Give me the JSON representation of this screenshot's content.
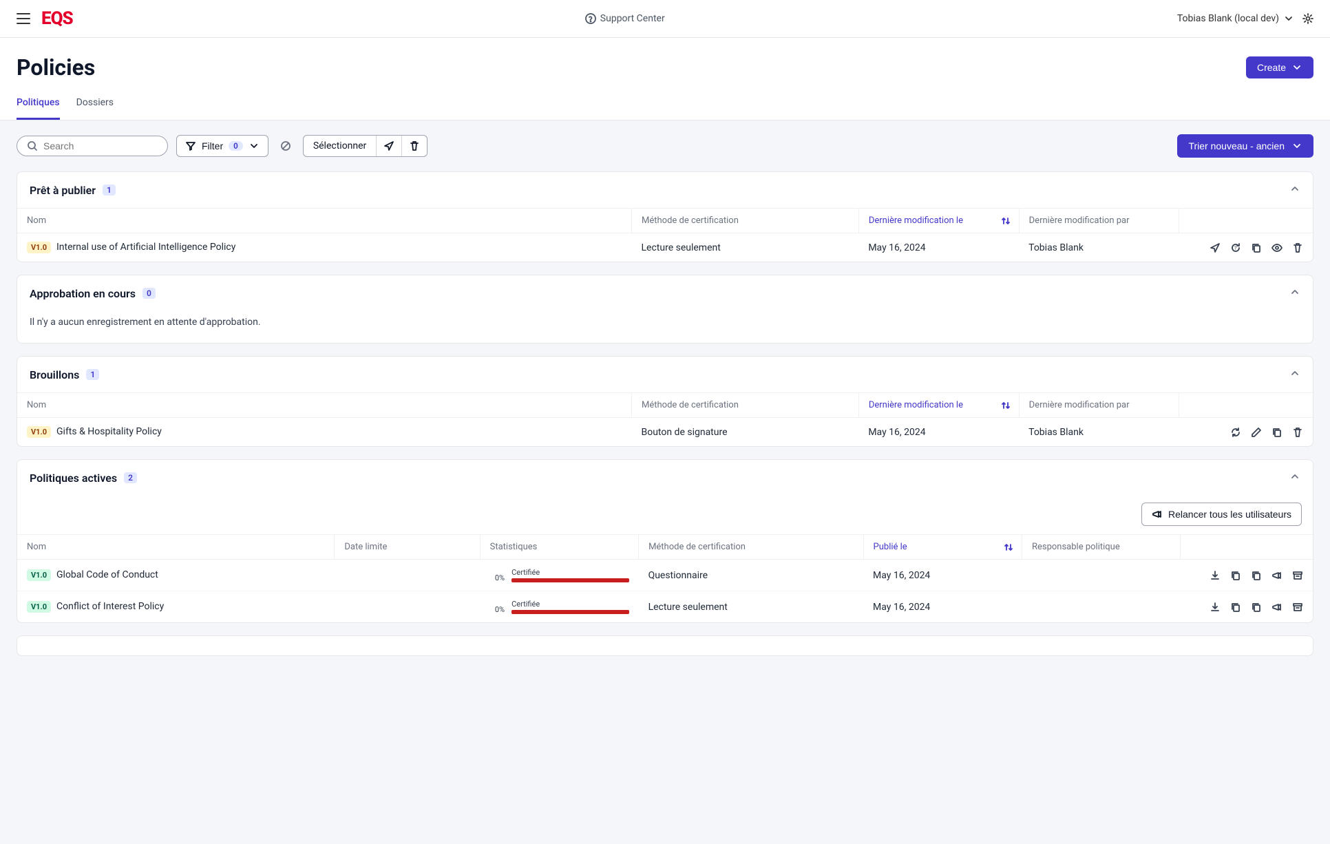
{
  "header": {
    "support_label": "Support Center",
    "user_label": "Tobias Blank (local dev)"
  },
  "page": {
    "title": "Policies",
    "create_label": "Create",
    "tabs": {
      "policies": "Politiques",
      "folders": "Dossiers"
    }
  },
  "toolbar": {
    "search_placeholder": "Search",
    "filter_label": "Filter",
    "filter_count": "0",
    "select_label": "Sélectionner",
    "sort_label": "Trier nouveau - ancien"
  },
  "columns": {
    "name": "Nom",
    "method": "Méthode de certification",
    "modified_on": "Dernière modification le",
    "modified_by": "Dernière modification par",
    "deadline": "Date limite",
    "stats": "Statistiques",
    "published_on": "Publié le",
    "owner": "Responsable politique"
  },
  "sections": {
    "ready": {
      "title": "Prêt à publier",
      "count": "1",
      "rows": [
        {
          "version": "V1.0",
          "name": "Internal use of Artificial Intelligence Policy",
          "method": "Lecture seulement",
          "date": "May 16, 2024",
          "user": "Tobias Blank"
        }
      ]
    },
    "approval": {
      "title": "Approbation en cours",
      "count": "0",
      "empty": "Il n'y a aucun enregistrement en attente d'approbation."
    },
    "drafts": {
      "title": "Brouillons",
      "count": "1",
      "rows": [
        {
          "version": "V1.0",
          "name": "Gifts & Hospitality Policy",
          "method": "Bouton de signature",
          "date": "May 16, 2024",
          "user": "Tobias Blank"
        }
      ]
    },
    "active": {
      "title": "Politiques actives",
      "count": "2",
      "remind_label": "Relancer tous les utilisateurs",
      "stat_label": "Certifiée",
      "rows": [
        {
          "version": "V1.0",
          "name": "Global Code of Conduct",
          "pct": "0%",
          "method": "Questionnaire",
          "date": "May 16, 2024"
        },
        {
          "version": "V1.0",
          "name": "Conflict of Interest Policy",
          "pct": "0%",
          "method": "Lecture seulement",
          "date": "May 16, 2024"
        }
      ]
    }
  }
}
